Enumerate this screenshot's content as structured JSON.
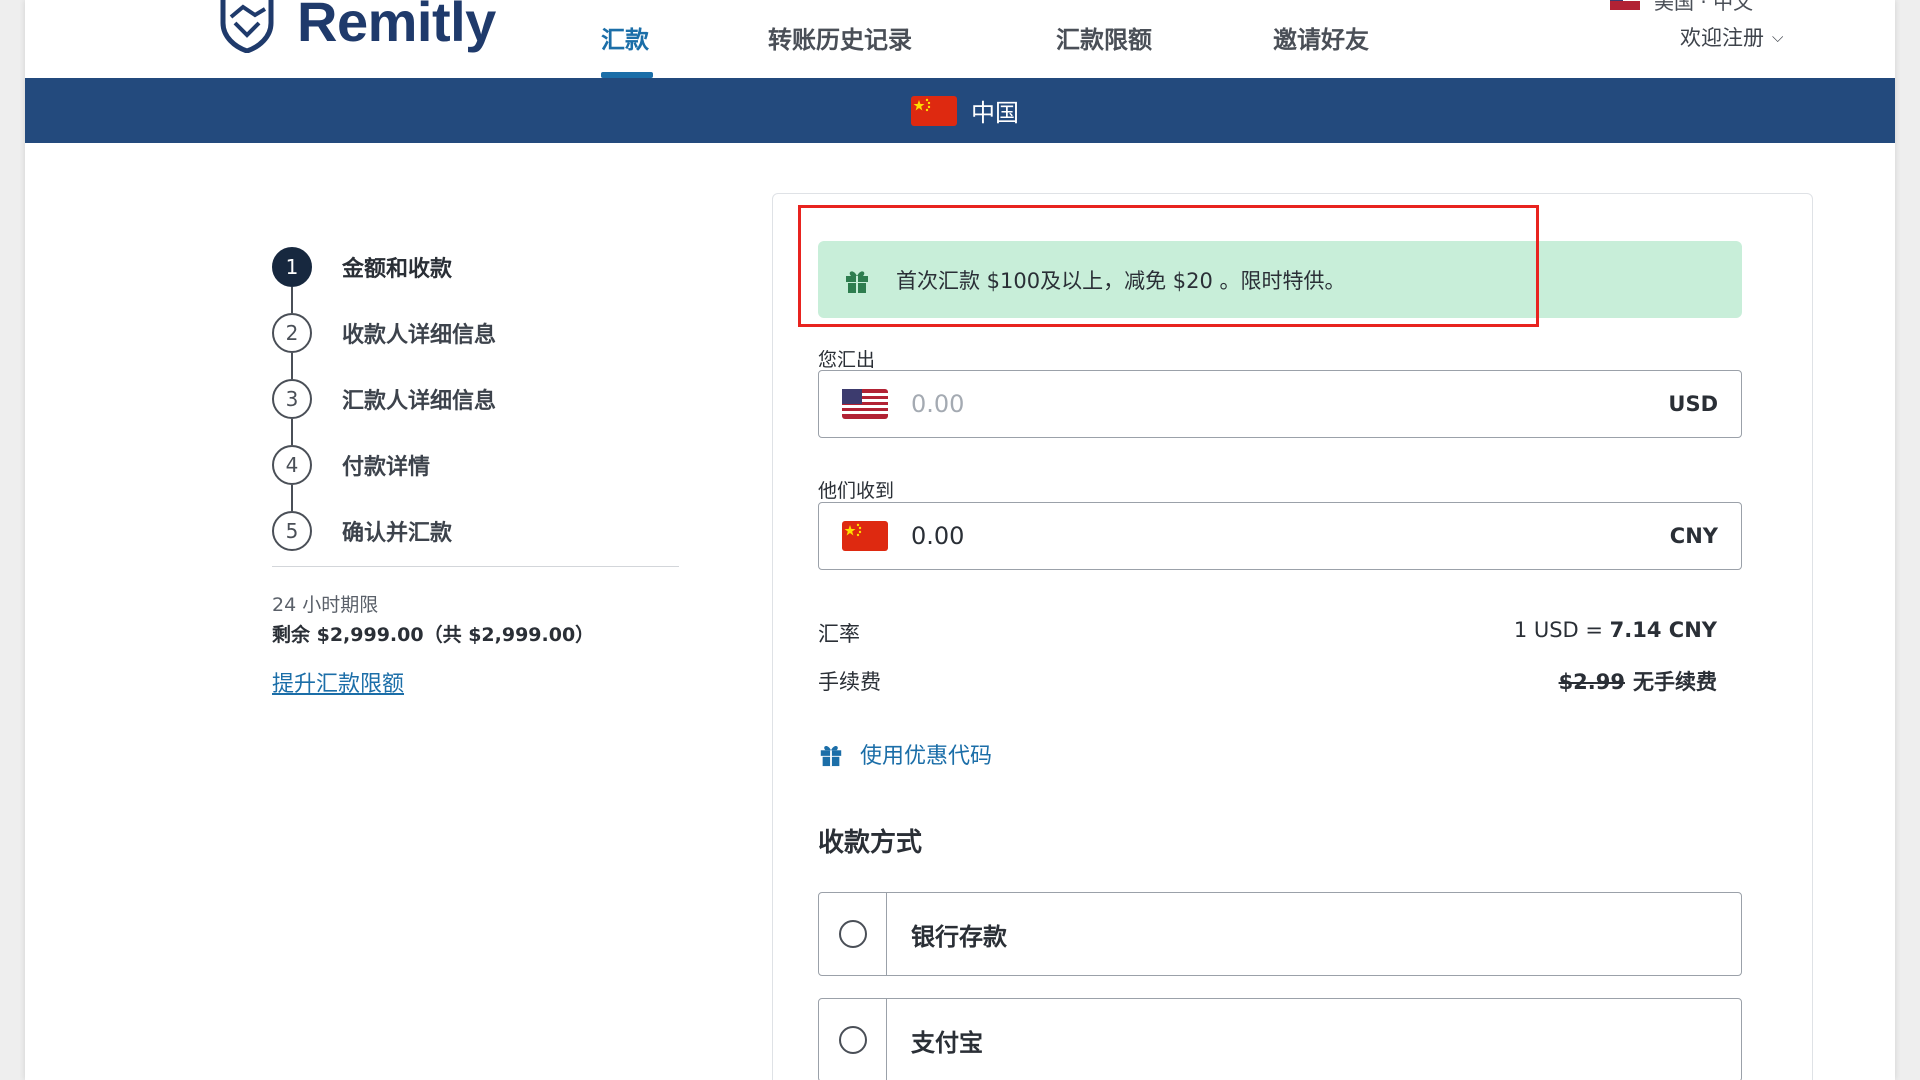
{
  "brand": {
    "name": "Remitly"
  },
  "nav": {
    "items": [
      {
        "label": "汇款",
        "active": true
      },
      {
        "label": "转账历史记录",
        "active": false
      },
      {
        "label": "汇款限额",
        "active": false
      },
      {
        "label": "邀请好友",
        "active": false
      }
    ],
    "signup_label": "欢迎注册",
    "language_label": "美国 · 中文"
  },
  "destination": {
    "country": "中国"
  },
  "steps": [
    {
      "number": "1",
      "label": "金额和收款",
      "current": true
    },
    {
      "number": "2",
      "label": "收款人详细信息",
      "current": false
    },
    {
      "number": "3",
      "label": "汇款人详细信息",
      "current": false
    },
    {
      "number": "4",
      "label": "付款详情",
      "current": false
    },
    {
      "number": "5",
      "label": "确认并汇款",
      "current": false
    }
  ],
  "limits": {
    "title": "24 小时期限",
    "remaining": "剩余 $2,999.00（共 $2,999.00）",
    "raise_link": "提升汇款限额"
  },
  "promo_banner": {
    "text": "首次汇款 $100及以上，减免 $20 。限时特供。"
  },
  "send": {
    "label": "您汇出",
    "placeholder": "0.00",
    "value": "",
    "currency": "USD"
  },
  "receive": {
    "label": "他们收到",
    "value": "0.00",
    "currency": "CNY"
  },
  "exchange_rate": {
    "label": "汇率",
    "prefix": "1 USD = ",
    "value": "7.14 CNY"
  },
  "fee": {
    "label": "手续费",
    "original": "$2.99",
    "current": "无手续费"
  },
  "promo_code_link": "使用优惠代码",
  "delivery": {
    "title": "收款方式",
    "options": [
      {
        "label": "银行存款"
      },
      {
        "label": "支付宝"
      }
    ]
  },
  "colors": {
    "brand_blue": "#1f3a6b",
    "link_blue": "#1b6ea8",
    "band_blue": "#234a7d",
    "promo_green": "#c8eed9",
    "highlight_red": "#e8231f"
  }
}
